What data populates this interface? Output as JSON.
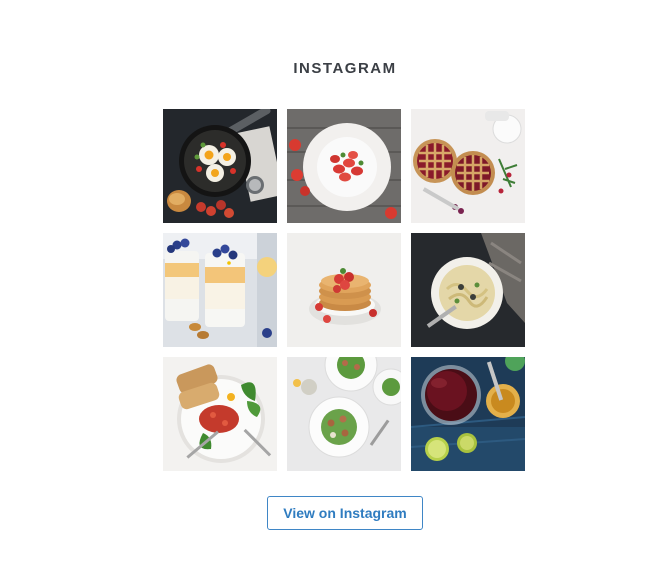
{
  "title": "INSTAGRAM",
  "button_label": "View on Instagram",
  "accent_color": "#2f7cc0",
  "photos": [
    {
      "subject": "eggs-skillet"
    },
    {
      "subject": "strawberry-plate"
    },
    {
      "subject": "berry-pies"
    },
    {
      "subject": "yogurt-parfaits"
    },
    {
      "subject": "pancake-stack"
    },
    {
      "subject": "pasta-bowl"
    },
    {
      "subject": "toast-salad"
    },
    {
      "subject": "salad-plates"
    },
    {
      "subject": "wine-honey"
    }
  ]
}
